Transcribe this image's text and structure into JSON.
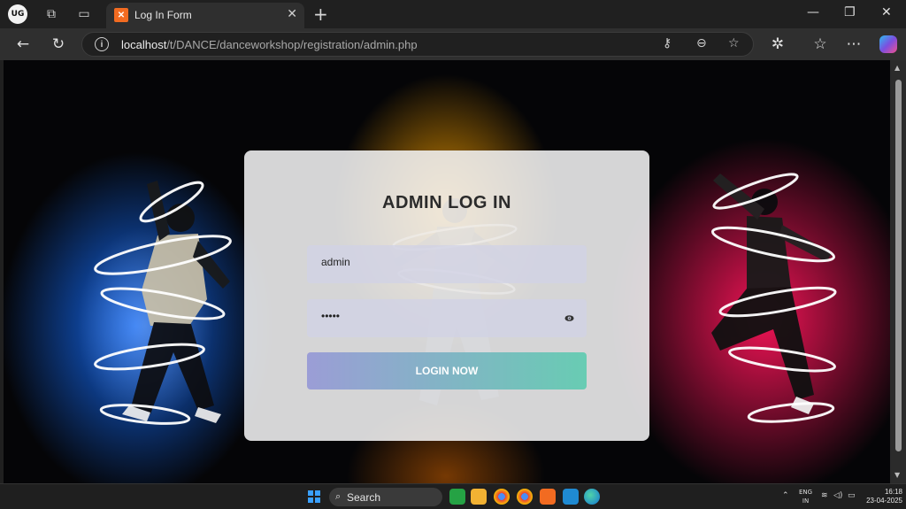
{
  "browser": {
    "profile_label": "UG",
    "tab_title": "Log In Form",
    "tab_favicon": "xampp-favicon",
    "url_host": "localhost",
    "url_path": "/t/DANCE/danceworkshop/registration/admin.php"
  },
  "login": {
    "title": "ADMIN LOG IN",
    "username_value": "admin",
    "password_value": "•••••",
    "button_label": "LOGIN NOW"
  },
  "taskbar": {
    "search_label": "Search",
    "lang_line1": "ENG",
    "lang_line2": "IN",
    "time": "16:18",
    "date": "23-04-2025"
  },
  "colors": {
    "button_gradient_start": "#9b9dd6",
    "button_gradient_end": "#68ccb3",
    "left_glow": "#146eff",
    "right_glow": "#ff145a",
    "center_glow": "#ffa500"
  }
}
